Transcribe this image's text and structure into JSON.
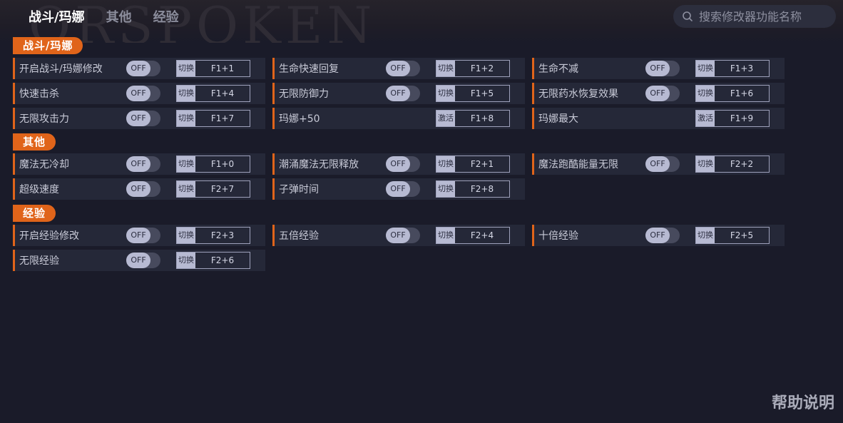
{
  "background_text": "ORSPOKEN",
  "tabs": [
    {
      "label": "战斗/玛娜"
    },
    {
      "label": "其他"
    },
    {
      "label": "经验"
    }
  ],
  "search": {
    "placeholder": "搜索修改器功能名称",
    "value": ""
  },
  "sections": [
    {
      "title": "战斗/玛娜",
      "rows": [
        [
          {
            "label": "开启战斗/玛娜修改",
            "toggle": "OFF",
            "action": "切换",
            "key": "F1+1"
          },
          {
            "label": "生命快速回复",
            "toggle": "OFF",
            "action": "切换",
            "key": "F1+2"
          },
          {
            "label": "生命不减",
            "toggle": "OFF",
            "action": "切换",
            "key": "F1+3"
          }
        ],
        [
          {
            "label": "快速击杀",
            "toggle": "OFF",
            "action": "切换",
            "key": "F1+4"
          },
          {
            "label": "无限防御力",
            "toggle": "OFF",
            "action": "切换",
            "key": "F1+5"
          },
          {
            "label": "无限药水恢复效果",
            "toggle": "OFF",
            "action": "切换",
            "key": "F1+6"
          }
        ],
        [
          {
            "label": "无限攻击力",
            "toggle": "OFF",
            "action": "切换",
            "key": "F1+7"
          },
          {
            "label": "玛娜+50",
            "toggle": null,
            "action": "激活",
            "key": "F1+8"
          },
          {
            "label": "玛娜最大",
            "toggle": null,
            "action": "激活",
            "key": "F1+9"
          }
        ]
      ]
    },
    {
      "title": "其他",
      "rows": [
        [
          {
            "label": "魔法无冷却",
            "toggle": "OFF",
            "action": "切换",
            "key": "F1+0"
          },
          {
            "label": "潮涌魔法无限释放",
            "toggle": "OFF",
            "action": "切换",
            "key": "F2+1"
          },
          {
            "label": "魔法跑酷能量无限",
            "toggle": "OFF",
            "action": "切换",
            "key": "F2+2"
          }
        ],
        [
          {
            "label": "超级速度",
            "toggle": "OFF",
            "action": "切换",
            "key": "F2+7"
          },
          {
            "label": "子弹时间",
            "toggle": "OFF",
            "action": "切换",
            "key": "F2+8"
          }
        ]
      ]
    },
    {
      "title": "经验",
      "rows": [
        [
          {
            "label": "开启经验修改",
            "toggle": "OFF",
            "action": "切换",
            "key": "F2+3"
          },
          {
            "label": "五倍经验",
            "toggle": "OFF",
            "action": "切换",
            "key": "F2+4"
          },
          {
            "label": "十倍经验",
            "toggle": "OFF",
            "action": "切换",
            "key": "F2+5"
          }
        ],
        [
          {
            "label": "无限经验",
            "toggle": "OFF",
            "action": "切换",
            "key": "F2+6"
          }
        ]
      ]
    }
  ],
  "help_label": "帮助说明",
  "colors": {
    "accent": "#e0641a",
    "background": "#1a1b29",
    "card": "#252838"
  },
  "icons": {
    "search": "search-icon"
  }
}
